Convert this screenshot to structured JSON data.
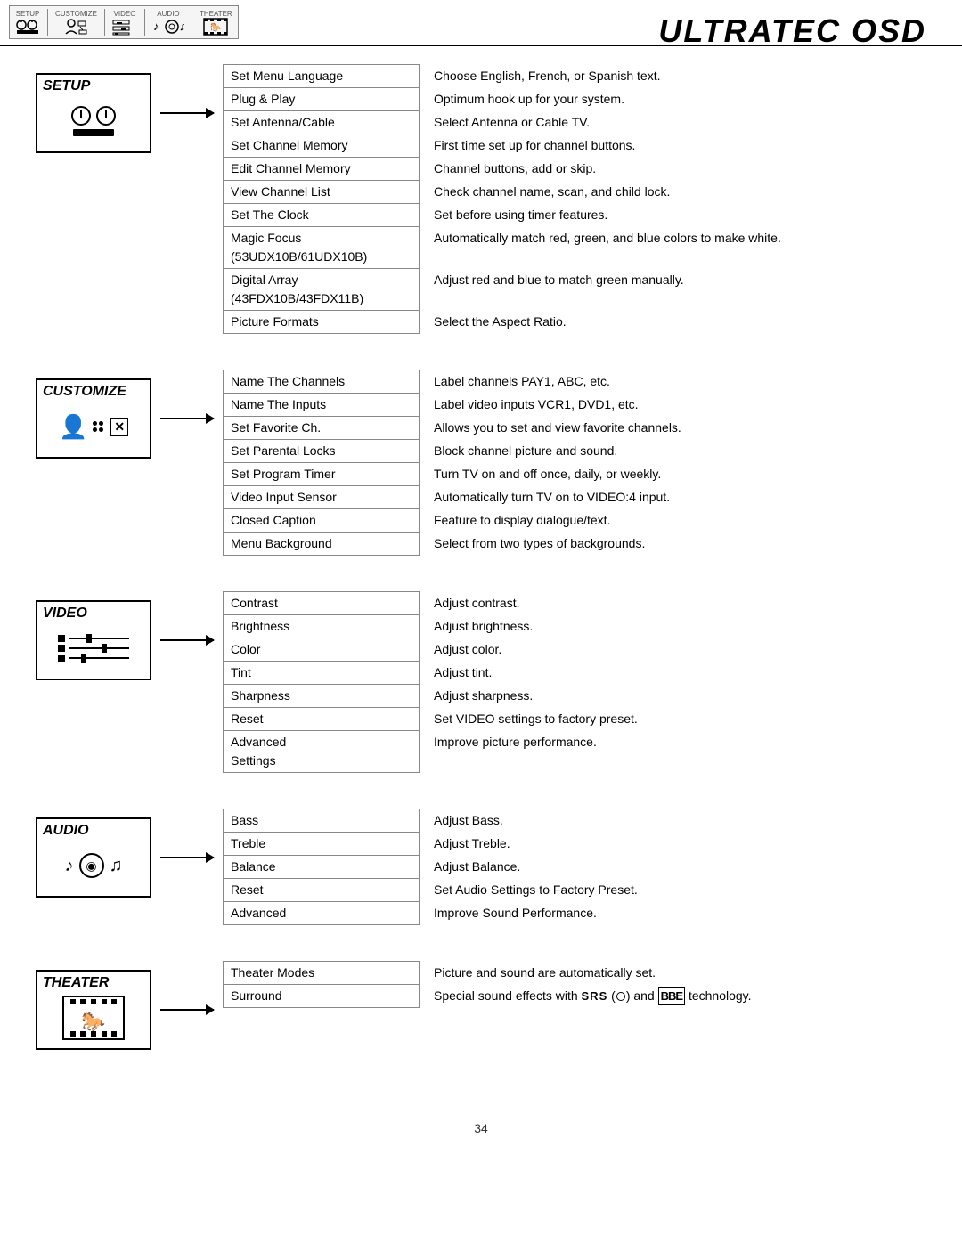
{
  "page": {
    "title": "ULTRATEC OSD",
    "page_number": "34"
  },
  "header": {
    "tabs": [
      {
        "label": "SETUP",
        "icon": "setup-icon"
      },
      {
        "label": "CUSTOMIZE",
        "icon": "customize-icon"
      },
      {
        "label": "VIDEO",
        "icon": "video-icon"
      },
      {
        "label": "AUDIO",
        "icon": "audio-icon"
      },
      {
        "label": "THEATER",
        "icon": "theater-icon"
      }
    ]
  },
  "sections": [
    {
      "id": "setup",
      "label": "SETUP",
      "items": [
        {
          "name": "Set Menu Language",
          "description": "Choose English, French, or Spanish text."
        },
        {
          "name": "Plug & Play",
          "description": "Optimum hook up for your system."
        },
        {
          "name": "Set Antenna/Cable",
          "description": "Select Antenna or Cable TV."
        },
        {
          "name": "Set Channel Memory",
          "description": "First time set up for channel buttons."
        },
        {
          "name": "Edit Channel Memory",
          "description": "Channel buttons, add or skip."
        },
        {
          "name": "View Channel List",
          "description": "Check channel name, scan, and child lock."
        },
        {
          "name": "Set The Clock",
          "description": "Set before using timer features."
        },
        {
          "name": "Magic Focus\n(53UDX10B/61UDX10B)",
          "description": "Automatically match red, green, and blue colors to make white."
        },
        {
          "name": "Digital Array\n(43FDX10B/43FDX11B)",
          "description": "Adjust red and blue to match green manually."
        },
        {
          "name": "Picture Formats",
          "description": "Select  the Aspect Ratio."
        }
      ]
    },
    {
      "id": "customize",
      "label": "CUSTOMIZE",
      "items": [
        {
          "name": "Name The Channels",
          "description": "Label channels PAY1, ABC, etc."
        },
        {
          "name": "Name The Inputs",
          "description": "Label video inputs VCR1, DVD1, etc."
        },
        {
          "name": "Set Favorite Ch.",
          "description": "Allows you to set and view favorite channels."
        },
        {
          "name": "Set Parental Locks",
          "description": "Block channel picture and sound."
        },
        {
          "name": "Set Program Timer",
          "description": "Turn TV on and off once, daily, or weekly."
        },
        {
          "name": "Video Input Sensor",
          "description": "Automatically turn TV on to VIDEO:4 input."
        },
        {
          "name": "Closed Caption",
          "description": "Feature to display dialogue/text."
        },
        {
          "name": "Menu Background",
          "description": "Select from two types of backgrounds."
        }
      ]
    },
    {
      "id": "video",
      "label": "VIDEO",
      "items": [
        {
          "name": "Contrast",
          "description": "Adjust contrast."
        },
        {
          "name": "Brightness",
          "description": "Adjust brightness."
        },
        {
          "name": "Color",
          "description": "Adjust color."
        },
        {
          "name": "Tint",
          "description": "Adjust tint."
        },
        {
          "name": "Sharpness",
          "description": "Adjust sharpness."
        },
        {
          "name": "Reset",
          "description": "Set VIDEO settings to factory preset."
        },
        {
          "name": "Advanced\nSettings",
          "description": "Improve picture performance."
        }
      ]
    },
    {
      "id": "audio",
      "label": "AUDIO",
      "items": [
        {
          "name": "Bass",
          "description": "Adjust Bass."
        },
        {
          "name": "Treble",
          "description": "Adjust Treble."
        },
        {
          "name": "Balance",
          "description": "Adjust Balance."
        },
        {
          "name": "Reset",
          "description": "Set Audio Settings to Factory Preset."
        },
        {
          "name": "Advanced",
          "description": "Improve Sound Performance."
        }
      ]
    },
    {
      "id": "theater",
      "label": "THEATER",
      "items": [
        {
          "name": "Theater Modes",
          "description": "Picture and sound are automatically set."
        },
        {
          "name": "Surround",
          "description": "Special sound effects with SRS (●) and BBE technology."
        }
      ]
    }
  ]
}
